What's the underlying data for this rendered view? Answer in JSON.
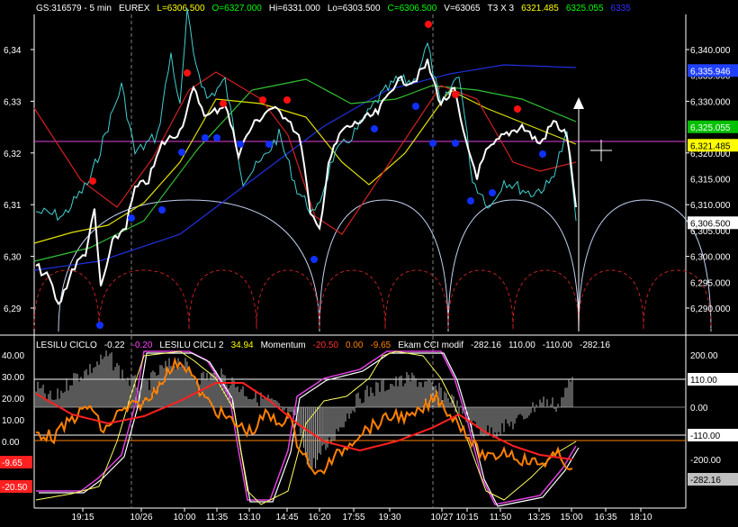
{
  "header": {
    "items": [
      {
        "text": "GS:316579 - 5 min",
        "color": "#ffffff"
      },
      {
        "text": "EUREX",
        "color": "#ffffff"
      },
      {
        "text": "L=6306.500",
        "color": "#ffff00"
      },
      {
        "text": "O=6327.000",
        "color": "#00ff00"
      },
      {
        "text": "Hi=6331.000",
        "color": "#ffffff"
      },
      {
        "text": "Lo=6303.500",
        "color": "#ffffff"
      },
      {
        "text": "C=6306.500",
        "color": "#00ff00"
      },
      {
        "text": "V=63065",
        "color": "#ffffff"
      },
      {
        "text": "T3 X 3",
        "color": "#ffffff"
      },
      {
        "text": "6321.485",
        "color": "#ffff00"
      },
      {
        "text": "6325.055",
        "color": "#00ff00"
      },
      {
        "text": "6335",
        "color": "#3030ff"
      }
    ]
  },
  "price_axis": {
    "left_labels": [
      "6,34",
      "6,33",
      "6,32",
      "6,31",
      "6,30",
      "6,29"
    ],
    "right_labels": [
      "6,340.000",
      "6,330.000",
      "6,320.000",
      "6,310.000",
      "6,300.000",
      "6,290.000"
    ],
    "right_labels_minor": [
      "6,335.000",
      "6,325.000",
      "6,315.000",
      "6,305.000",
      "6,295.000"
    ],
    "badges": [
      {
        "text": "6,335.946",
        "bg": "#2040ff",
        "fg": "#ffffff"
      },
      {
        "text": "6,325.055",
        "bg": "#00c000",
        "fg": "#ffffff"
      },
      {
        "text": "6,321.485",
        "bg": "#ffff00",
        "fg": "#000000"
      },
      {
        "text": "6,306.500",
        "bg": "#ffffff",
        "fg": "#000000"
      }
    ]
  },
  "indicator_header": {
    "items": [
      {
        "text": "LESILU CICLO",
        "color": "#ffffff"
      },
      {
        "text": "-0.22",
        "color": "#ffffff"
      },
      {
        "text": "-0.20",
        "color": "#ff40ff"
      },
      {
        "text": "LESILU CICLI 2",
        "color": "#ffffff"
      },
      {
        "text": "34.94",
        "color": "#ffff00"
      },
      {
        "text": "Momentum",
        "color": "#ffffff"
      },
      {
        "text": "-20.50",
        "color": "#ff3030"
      },
      {
        "text": "0.00",
        "color": "#ff8000"
      },
      {
        "text": "-9.65",
        "color": "#ff8000"
      },
      {
        "text": "Ekam CCI modif",
        "color": "#ffffff"
      },
      {
        "text": "-282.16",
        "color": "#ffffff"
      },
      {
        "text": "110.00",
        "color": "#ffffff"
      },
      {
        "text": "-110.00",
        "color": "#ffffff"
      },
      {
        "text": "-282.16",
        "color": "#ffffff"
      }
    ]
  },
  "indicator_axis": {
    "left_labels": [
      "40.00",
      "30.00",
      "20.00",
      "10.00",
      "0.00"
    ],
    "right_labels": [
      "200.00",
      "100.00",
      "0.00",
      "-100.00",
      "-200.00"
    ],
    "left_badges": [
      {
        "text": "-9.65",
        "bg": "#ff2020",
        "fg": "#ffffff"
      },
      {
        "text": "-20.50",
        "bg": "#ff2020",
        "fg": "#ffffff"
      }
    ],
    "right_badges": [
      {
        "text": "110.00",
        "bg": "#ffffff",
        "fg": "#000000"
      },
      {
        "text": "-110.00",
        "bg": "#ffffff",
        "fg": "#000000"
      },
      {
        "text": "-282.16",
        "bg": "#c0c0c0",
        "fg": "#000000"
      }
    ]
  },
  "time_axis": {
    "labels": [
      "19:15",
      "10/26",
      "10:00",
      "11:35",
      "13:10",
      "14:45",
      "16:20",
      "17:55",
      "19:30",
      "10/27",
      "10:15",
      "11:50",
      "13:25",
      "15:00",
      "16:35",
      "18:10"
    ]
  },
  "colors": {
    "price": "#ffffff",
    "fast": "#40d0d0",
    "ma_red": "#d02020",
    "ma_yellow": "#e0e000",
    "ma_green": "#30c030",
    "ma_blue": "#2030e0",
    "cycle": "#c0d0f0",
    "magenta_line": "#e040e0",
    "momentum": "#ff8000",
    "cci_red": "#ff2020"
  }
}
